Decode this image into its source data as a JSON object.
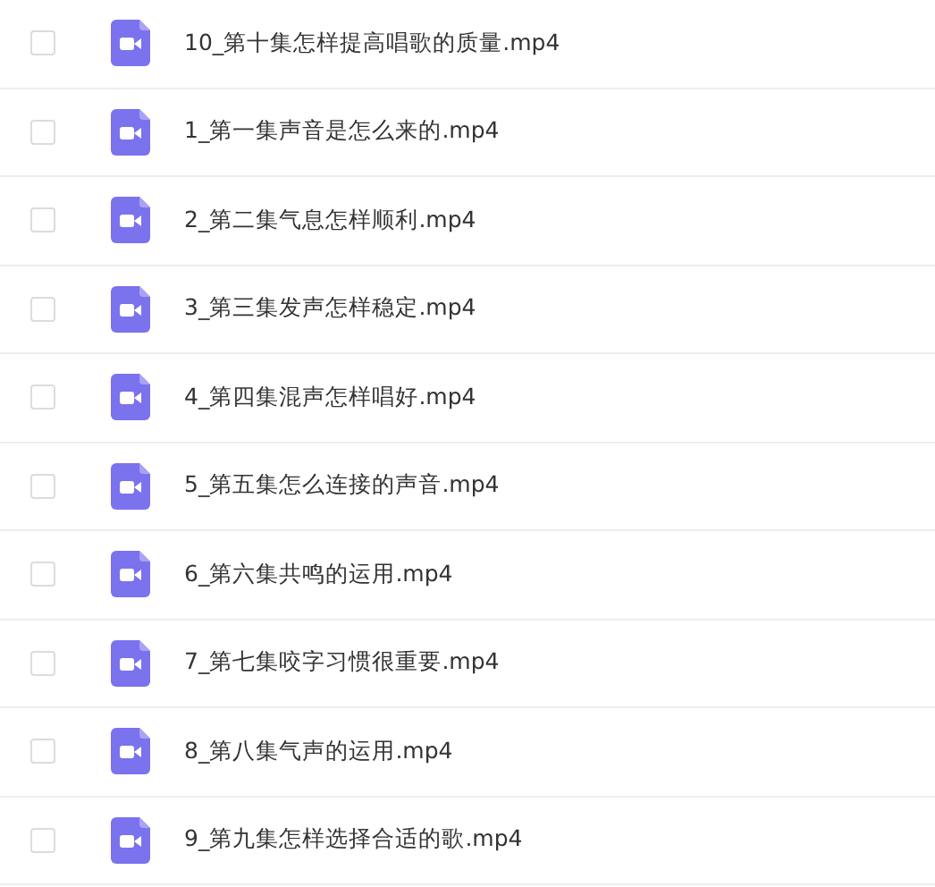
{
  "files": [
    {
      "name": "10_第十集怎样提高唱歌的质量.mp4",
      "checked": false
    },
    {
      "name": "1_第一集声音是怎么来的.mp4",
      "checked": false
    },
    {
      "name": "2_第二集气息怎样顺利.mp4",
      "checked": false
    },
    {
      "name": "3_第三集发声怎样稳定.mp4",
      "checked": false
    },
    {
      "name": "4_第四集混声怎样唱好.mp4",
      "checked": false
    },
    {
      "name": "5_第五集怎么连接的声音.mp4",
      "checked": false
    },
    {
      "name": "6_第六集共鸣的运用.mp4",
      "checked": false
    },
    {
      "name": "7_第七集咬字习惯很重要.mp4",
      "checked": false
    },
    {
      "name": "8_第八集气声的运用.mp4",
      "checked": false
    },
    {
      "name": "9_第九集怎样选择合适的歌.mp4",
      "checked": false
    }
  ]
}
